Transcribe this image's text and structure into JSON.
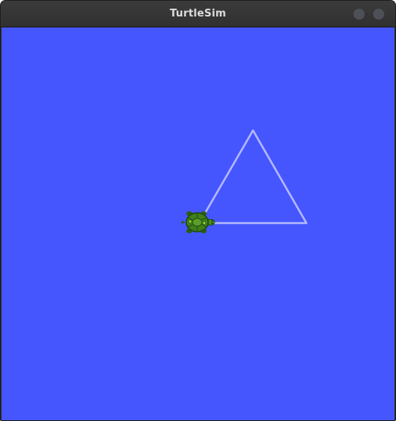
{
  "window": {
    "title": "TurtleSim",
    "background_color": "#4556ff",
    "pen_color": "#b3b8ff",
    "controls": [
      "minimize-icon",
      "close-icon"
    ]
  },
  "turtle": {
    "icon": "turtle-icon",
    "shell_color": "#3f7f1c"
  }
}
